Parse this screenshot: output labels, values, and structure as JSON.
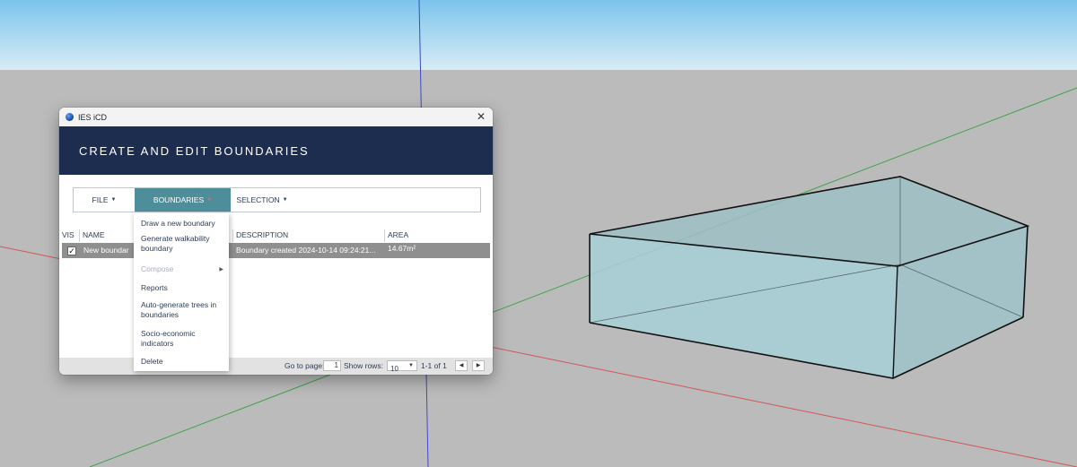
{
  "window": {
    "title": "IES iCD",
    "close_glyph": "✕",
    "icon": "ies-app-icon"
  },
  "header": {
    "title": "CREATE AND EDIT BOUNDARIES"
  },
  "menubar": {
    "file_label": "FILE",
    "boundaries_label": "BOUNDARIES",
    "selection_label": "SELECTION",
    "caret": "▼",
    "active_color": "#4e8e9b"
  },
  "table": {
    "headers": {
      "vis": "VIS",
      "name": "NAME",
      "description": "DESCRIPTION",
      "area": "AREA"
    },
    "rows": [
      {
        "checked": "✓",
        "name": "New boundar",
        "description": "Boundary created 2024-10-14 09:24:21...",
        "area": "14.67m²"
      }
    ]
  },
  "footer": {
    "go_to_page_label": "Go to page:",
    "page_value": "1",
    "show_rows_label": "Show rows:",
    "rows_value": "10",
    "range_text": "1-1 of 1",
    "prev_glyph": "◀",
    "next_glyph": "▶"
  },
  "dropdown": {
    "items": [
      {
        "label": "Draw a new boundary"
      },
      {
        "label": "Generate walkability boundary"
      },
      {
        "label": "Compose",
        "disabled": true,
        "submenu_glyph": "▶"
      },
      {
        "label": "Reports"
      },
      {
        "label": "Auto-generate trees in boundaries"
      },
      {
        "label": "Socio-economic indicators"
      },
      {
        "label": "Delete"
      }
    ]
  },
  "colors": {
    "sky_top": "#7cc4ec",
    "sky_bottom": "#d8ecf6",
    "ground": "#bbbbbb",
    "header_band": "#1c2d50",
    "box_face": "#a8ccd2",
    "row_highlight": "#8f8f8f"
  }
}
